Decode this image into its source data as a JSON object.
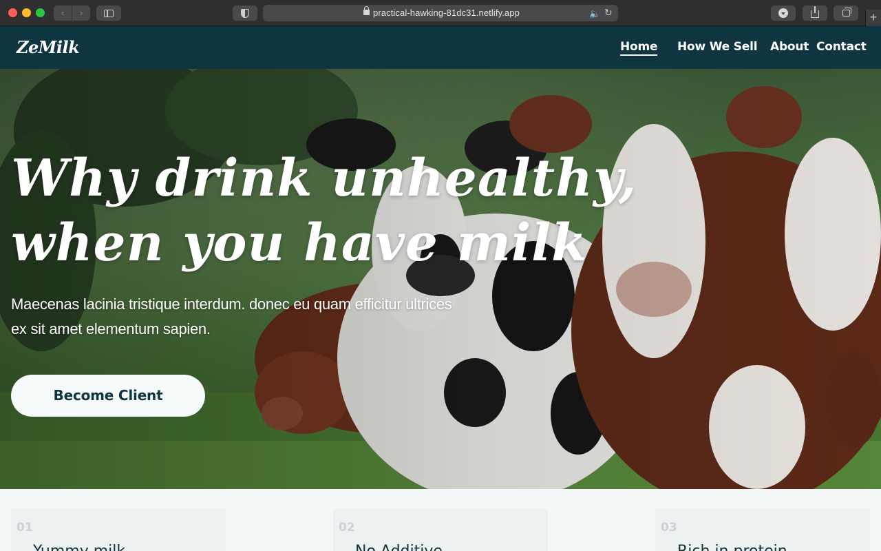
{
  "browser": {
    "url": "practical-hawking-81dc31.netlify.app",
    "back_icon": "chevron-left-icon",
    "forward_icon": "chevron-right-icon"
  },
  "site": {
    "logo": "ZeMilk",
    "nav": [
      {
        "label": "Home",
        "active": true
      },
      {
        "label": "How We Sell",
        "active": false
      },
      {
        "label": "About",
        "active": false
      },
      {
        "label": "Contact",
        "active": false
      }
    ]
  },
  "hero": {
    "title_line1": "Why drink unhealthy,",
    "title_line2": "when you have milk",
    "subtitle": "Maecenas lacinia tristique interdum. donec eu quam efficitur ultrices ex sit amet elementum sapien.",
    "cta_label": "Become Client"
  },
  "features": [
    {
      "number": "01",
      "title": "Yummy milk"
    },
    {
      "number": "02",
      "title": "No Additive"
    },
    {
      "number": "03",
      "title": "Rich in protein"
    }
  ],
  "colors": {
    "nav_bg": "#0f3540",
    "accent_text": "#0f3540",
    "button_bg": "#f7fafb",
    "features_bg": "#f4f8f9"
  }
}
